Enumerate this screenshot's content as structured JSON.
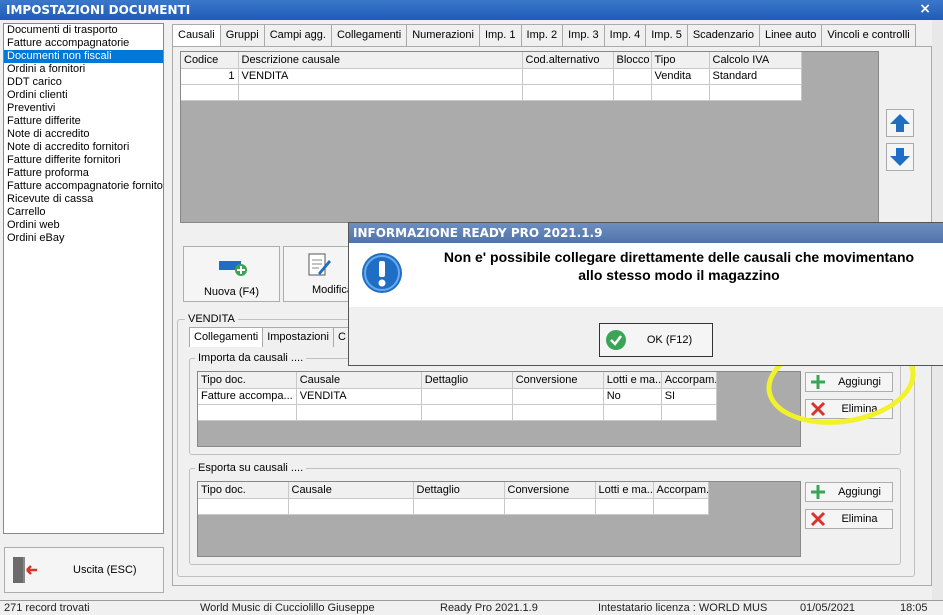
{
  "window": {
    "title": "IMPOSTAZIONI DOCUMENTI",
    "close": "×"
  },
  "doc_list": {
    "items": [
      "Documenti di trasporto",
      "Fatture accompagnatorie",
      "Documenti non fiscali",
      "Ordini a fornitori",
      "DDT carico",
      "Ordini clienti",
      "Preventivi",
      "Fatture differite",
      "Note di accredito",
      "Note di accredito fornitori",
      "Fatture differite fornitori",
      "Fatture proforma",
      "Fatture accompagnatorie fornito",
      "Ricevute di cassa",
      "Carrello",
      "Ordini web",
      "Ordini eBay"
    ],
    "selected": "Documenti non fiscali"
  },
  "exit_button": "Uscita (ESC)",
  "tabs": [
    "Causali",
    "Gruppi",
    "Campi agg.",
    "Collegamenti",
    "Numerazioni",
    "Imp. 1",
    "Imp. 2",
    "Imp. 3",
    "Imp. 4",
    "Imp. 5",
    "Scadenzario",
    "Linee auto",
    "Vincoli e controlli"
  ],
  "active_tab": "Causali",
  "causali_grid": {
    "columns": [
      "Codice",
      "Descrizione causale",
      "Cod.alternativo",
      "Blocco",
      "Tipo",
      "Calcolo IVA"
    ],
    "rows": [
      [
        "1",
        "VENDITA",
        "",
        "",
        "Vendita",
        "Standard"
      ]
    ]
  },
  "buttons": {
    "nuova": "Nuova (F4)",
    "modifica": "Modifica"
  },
  "section": {
    "name": "VENDITA",
    "subtabs": [
      "Collegamenti",
      "Impostazioni",
      "C"
    ]
  },
  "importa": {
    "label": "Importa da causali ....",
    "columns": [
      "Tipo doc.",
      "Causale",
      "Dettaglio",
      "Conversione",
      "Lotti e ma...",
      "Accorpam..."
    ],
    "rows": [
      [
        "Fatture accompa...",
        "VENDITA",
        "",
        "",
        "No",
        "SI"
      ]
    ],
    "add": "Aggiungi",
    "delete": "Elimina"
  },
  "esporta": {
    "label": "Esporta su causali ....",
    "columns": [
      "Tipo doc.",
      "Causale",
      "Dettaglio",
      "Conversione",
      "Lotti e ma...",
      "Accorpam..."
    ],
    "add": "Aggiungi",
    "delete": "Elimina"
  },
  "dialog": {
    "title": "INFORMAZIONE READY PRO 2021.1.9",
    "message_line1": "Non e' possibile collegare direttamente delle causali che movimentano",
    "message_line2": "allo stesso modo il magazzino",
    "ok": "OK (F12)"
  },
  "status_bar": {
    "records": "271 record trovati",
    "company": "World Music di Cucciolillo Giuseppe",
    "version": "Ready Pro 2021.1.9",
    "license": "Intestatario licenza : WORLD MUS",
    "date": "01/05/2021",
    "time": "18:05"
  },
  "colors": {
    "accent": "#0078d7",
    "highlight": "#f2f22a",
    "icon_blue": "#1e6fc4",
    "delete_red": "#d9342b",
    "add_green": "#3aa655"
  }
}
